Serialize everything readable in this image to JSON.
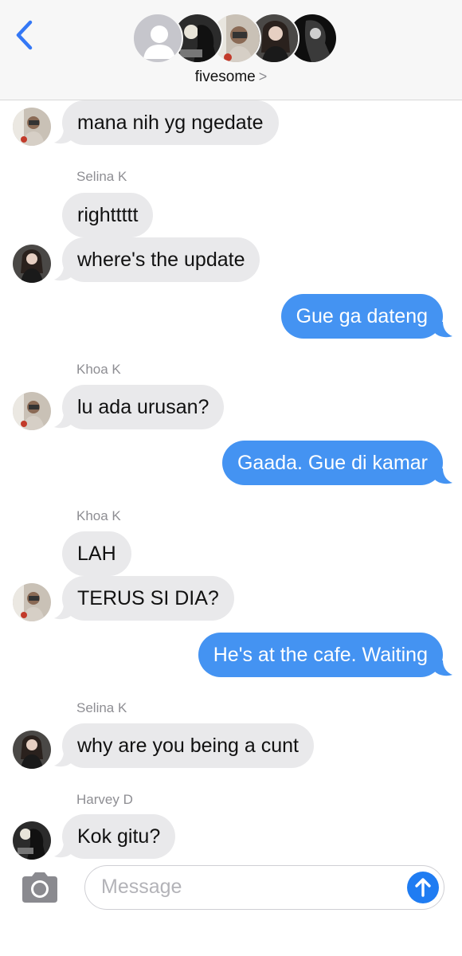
{
  "header": {
    "group_name": "fivesome",
    "chevron": ">",
    "icons": {
      "back": "chevron-left-icon",
      "avatar_placeholder": "person-icon"
    }
  },
  "messages": [
    {
      "type": "incoming",
      "text": "mana nih yg ngedate",
      "sender": ""
    },
    {
      "type": "incoming",
      "text": "righttttt",
      "sender": "Selina K"
    },
    {
      "type": "incoming",
      "text": "where's the update",
      "sender": ""
    },
    {
      "type": "outgoing",
      "text": "Gue ga dateng"
    },
    {
      "type": "incoming",
      "text": "lu ada urusan?",
      "sender": "Khoa K"
    },
    {
      "type": "outgoing",
      "text": "Gaada. Gue di kamar"
    },
    {
      "type": "incoming",
      "text": "LAH",
      "sender": "Khoa K"
    },
    {
      "type": "incoming",
      "text": "TERUS SI DIA?",
      "sender": ""
    },
    {
      "type": "outgoing",
      "text": "He's at the cafe. Waiting"
    },
    {
      "type": "incoming",
      "text": "why are you being a cunt",
      "sender": "Selina K"
    },
    {
      "type": "incoming",
      "text": "Kok gitu?",
      "sender": "Harvey D"
    }
  ],
  "senders": {
    "selina": "Selina K",
    "khoa": "Khoa K",
    "harvey": "Harvey D"
  },
  "input": {
    "placeholder": "Message",
    "value": "",
    "icons": {
      "camera": "camera-icon",
      "send": "arrow-up-icon"
    }
  },
  "colors": {
    "incoming_bubble": "#e9e9eb",
    "outgoing_bubble": "#4493f2",
    "accent": "#1f7cf2",
    "sender_label": "#8e8e93"
  }
}
